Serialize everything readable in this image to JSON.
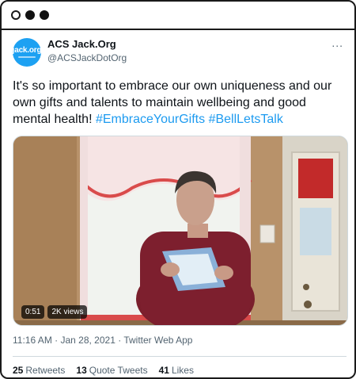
{
  "tweet": {
    "avatar": {
      "logo_text": "jack.org"
    },
    "display_name": "ACS Jack.Org",
    "handle": "@ACSJackDotOrg",
    "more_icon": "...",
    "text_plain": "It's so important to embrace our own uniqueness and our own gifts and talents to maintain wellbeing and good mental health!",
    "hashtags": [
      "#EmbraceYourGifts",
      "#BellLetsTalk"
    ],
    "video": {
      "duration": "0:51",
      "views": "2K views"
    },
    "timestamp": "11:16 AM · Jan 28, 2021 · Twitter Web App",
    "stats": [
      {
        "count": "25",
        "label": "Retweets"
      },
      {
        "count": "13",
        "label": "Quote Tweets"
      },
      {
        "count": "41",
        "label": "Likes"
      }
    ]
  },
  "colors": {
    "link": "#1d9bf0",
    "avatar_bg": "#1da1f2",
    "secondary_text": "#536471"
  }
}
